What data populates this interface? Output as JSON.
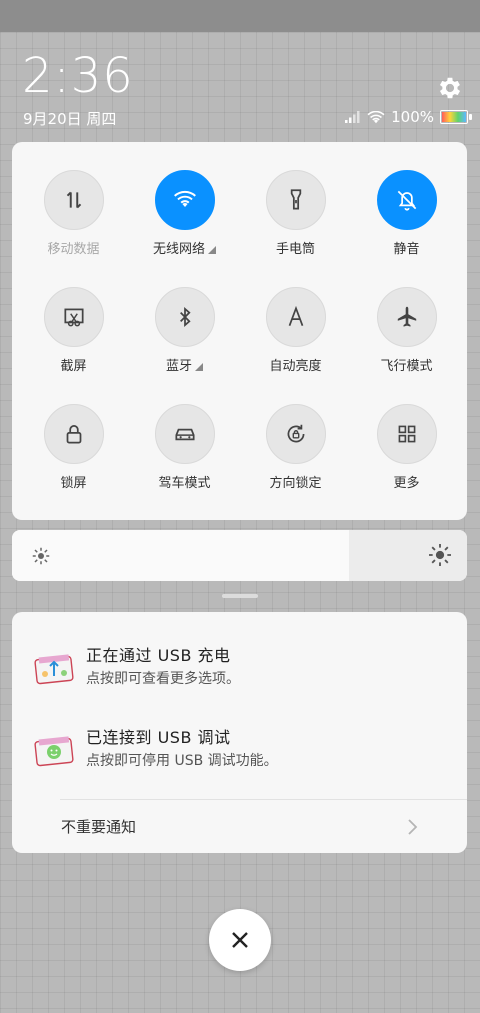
{
  "status_bar": {
    "time": "2:36",
    "date": "9月20日 周四",
    "battery_percent": "100%",
    "icons": [
      "signal-icon",
      "wifi-icon",
      "battery-icon",
      "settings-gear-icon"
    ]
  },
  "toggles": [
    {
      "label": "移动数据",
      "icon": "mobile-data-icon",
      "active": false,
      "disabled": true,
      "has_more": false
    },
    {
      "label": "无线网络",
      "icon": "wifi-icon",
      "active": true,
      "disabled": false,
      "has_more": true
    },
    {
      "label": "手电筒",
      "icon": "flashlight-icon",
      "active": false,
      "disabled": false,
      "has_more": false
    },
    {
      "label": "静音",
      "icon": "mute-bell-icon",
      "active": true,
      "disabled": false,
      "has_more": false
    },
    {
      "label": "截屏",
      "icon": "screenshot-icon",
      "active": false,
      "disabled": false,
      "has_more": false
    },
    {
      "label": "蓝牙",
      "icon": "bluetooth-icon",
      "active": false,
      "disabled": false,
      "has_more": true
    },
    {
      "label": "自动亮度",
      "icon": "auto-brightness-icon",
      "active": false,
      "disabled": false,
      "has_more": false
    },
    {
      "label": "飞行模式",
      "icon": "airplane-icon",
      "active": false,
      "disabled": false,
      "has_more": false
    },
    {
      "label": "锁屏",
      "icon": "lock-icon",
      "active": false,
      "disabled": false,
      "has_more": false
    },
    {
      "label": "驾车模式",
      "icon": "car-icon",
      "active": false,
      "disabled": false,
      "has_more": false
    },
    {
      "label": "方向锁定",
      "icon": "rotation-lock-icon",
      "active": false,
      "disabled": false,
      "has_more": false
    },
    {
      "label": "更多",
      "icon": "grid-more-icon",
      "active": false,
      "disabled": false,
      "has_more": false
    }
  ],
  "brightness": {
    "level": 0.74
  },
  "notifications": [
    {
      "title": "正在通过  USB  充电",
      "subtitle": "点按即可查看更多选项。",
      "icon": "usb-charge-icon"
    },
    {
      "title": "已连接到  USB  调试",
      "subtitle": "点按即可停用 USB 调试功能。",
      "icon": "usb-debug-icon"
    }
  ],
  "minor_notifications": {
    "label": "不重要通知"
  },
  "colors": {
    "accent": "#0a91ff",
    "panel": "#f7f7f7"
  }
}
